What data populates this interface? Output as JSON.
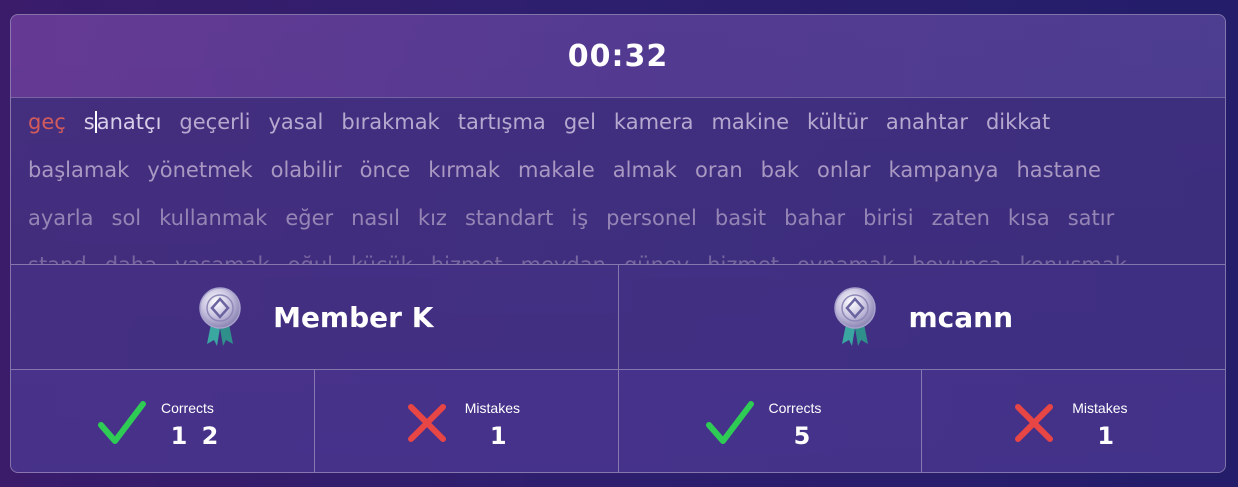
{
  "timer": "00:32",
  "words": {
    "line1": [
      "geç",
      "sanatçı",
      "geçerli",
      "yasal",
      "bırakmak",
      "tartışma",
      "gel",
      "kamera",
      "makine",
      "kültür",
      "anahtar",
      "dikkat"
    ],
    "line2": [
      "başlamak",
      "yönetmek",
      "olabilir",
      "önce",
      "kırmak",
      "makale",
      "almak",
      "oran",
      "bak",
      "onlar",
      "kampanya",
      "hastane"
    ],
    "line3": [
      "ayarla",
      "sol",
      "kullanmak",
      "eğer",
      "nasıl",
      "kız",
      "standart",
      "iş",
      "personel",
      "basit",
      "bahar",
      "birisi",
      "zaten",
      "kısa",
      "satır"
    ],
    "line4": [
      "stand",
      "daha",
      "yaşamak",
      "oğul",
      "küçük",
      "hizmet",
      "meydan",
      "güney",
      "hizmet",
      "oynamak",
      "boyunca",
      "konuşmak"
    ]
  },
  "current_word_first_letter": "s",
  "current_word_rest": "anatçı",
  "players": [
    {
      "name": "Member K",
      "icon": "medal-icon",
      "corrects_label": "Corrects",
      "corrects": "1 2",
      "mistakes_label": "Mistakes",
      "mistakes": "1"
    },
    {
      "name": "mcann",
      "icon": "medal-icon",
      "corrects_label": "Corrects",
      "corrects": "5",
      "mistakes_label": "Mistakes",
      "mistakes": "1"
    }
  ],
  "colors": {
    "typed_word": "#d25b5b",
    "check": "#2ecc55",
    "cross": "#e84545"
  }
}
